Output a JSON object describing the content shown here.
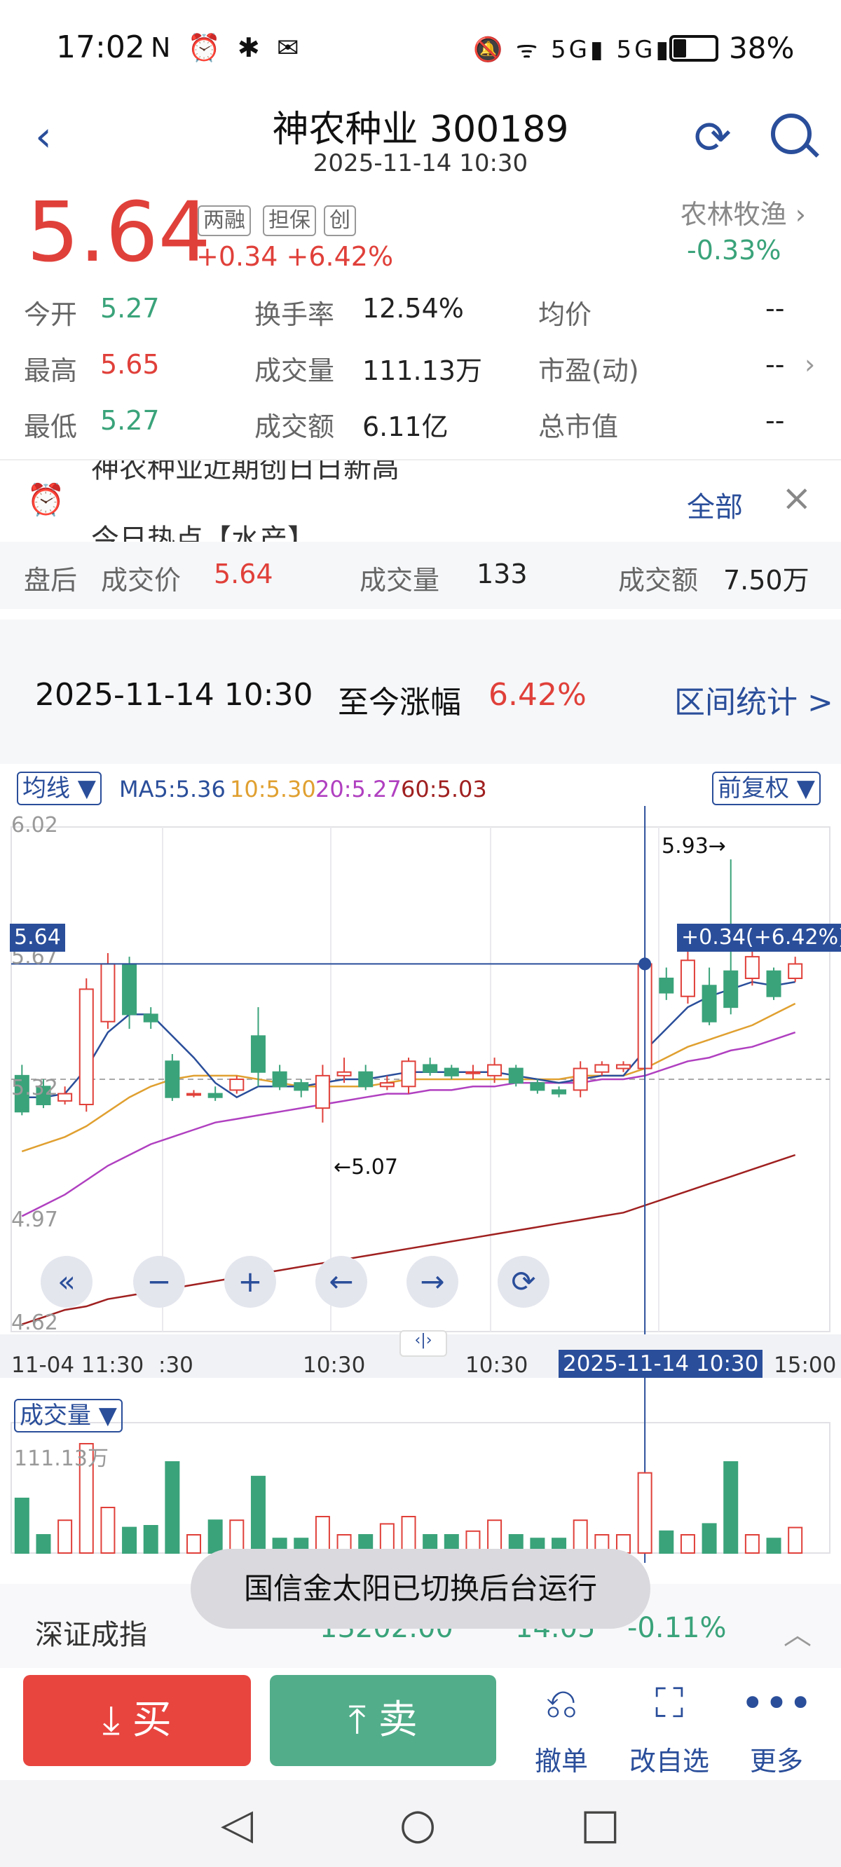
{
  "status": {
    "time": "17:02",
    "icons_left": "N ⏰ ✱ ✉",
    "icons_right": "🔕 ᯤ 5G▮ 5G▮",
    "battery_pct": "38%"
  },
  "header": {
    "title": "神农种业 300189",
    "subtitle": "2025-11-14 10:30"
  },
  "quote": {
    "price": "5.64",
    "tags": [
      "两融",
      "担保",
      "创"
    ],
    "change": "+0.34 +6.42%",
    "sector": "农林牧渔 ›",
    "sector_change": "-0.33%",
    "stats": [
      [
        {
          "label": "今开",
          "value": "5.27",
          "color": "green"
        },
        {
          "label": "换手率",
          "value": "12.54%"
        },
        {
          "label": "均价",
          "value": "--"
        }
      ],
      [
        {
          "label": "最高",
          "value": "5.65",
          "color": "red"
        },
        {
          "label": "成交量",
          "value": "111.13万"
        },
        {
          "label": "市盈(动)",
          "value": "--"
        }
      ],
      [
        {
          "label": "最低",
          "value": "5.27",
          "color": "green"
        },
        {
          "label": "成交额",
          "value": "6.11亿"
        },
        {
          "label": "总市值",
          "value": "--"
        }
      ]
    ]
  },
  "news": {
    "line1": "神农种业近期创日日新高",
    "line2": "今日热点【水产】",
    "all": "全部"
  },
  "after_hours": {
    "label": "盘后",
    "price_label": "成交价",
    "price": "5.64",
    "vol_label": "成交量",
    "vol": "133",
    "amt_label": "成交额",
    "amt": "7.50万"
  },
  "interval": {
    "date": "2025-11-14 10:30",
    "label": "至今涨幅",
    "value": "6.42%",
    "stats": "区间统计 >"
  },
  "chart_header": {
    "ma_button": "均线 ▼",
    "ma5": "MA5:5.36",
    "ma10": "10:5.30",
    "ma20": "20:5.27",
    "ma60": "60:5.03",
    "adjust": "前复权 ▼",
    "vol_button": "成交量 ▼"
  },
  "chart_data": {
    "type": "candlestick",
    "ylim": [
      4.62,
      6.02
    ],
    "y_ticks": [
      "6.02",
      "5.67",
      "5.32",
      "4.97",
      "4.62"
    ],
    "x_labels": [
      "11-04 11:30",
      ":30",
      "10:30",
      "10:30",
      "2025-11-14 10:30",
      "15:00"
    ],
    "crosshair_price": "5.64",
    "crosshair_label": "+0.34(+6.42%)",
    "high_annotation": "5.93→",
    "low_annotation": "←5.07",
    "candles": [
      {
        "o": 5.33,
        "c": 5.23,
        "h": 5.36,
        "l": 5.22
      },
      {
        "o": 5.3,
        "c": 5.25,
        "h": 5.32,
        "l": 5.24
      },
      {
        "o": 5.26,
        "c": 5.28,
        "h": 5.3,
        "l": 5.25
      },
      {
        "o": 5.25,
        "c": 5.57,
        "h": 5.6,
        "l": 5.23
      },
      {
        "o": 5.48,
        "c": 5.64,
        "h": 5.67,
        "l": 5.46
      },
      {
        "o": 5.64,
        "c": 5.5,
        "h": 5.66,
        "l": 5.46
      },
      {
        "o": 5.5,
        "c": 5.48,
        "h": 5.52,
        "l": 5.46
      },
      {
        "o": 5.37,
        "c": 5.27,
        "h": 5.39,
        "l": 5.26
      },
      {
        "o": 5.28,
        "c": 5.28,
        "h": 5.29,
        "l": 5.27
      },
      {
        "o": 5.28,
        "c": 5.27,
        "h": 5.3,
        "l": 5.26
      },
      {
        "o": 5.29,
        "c": 5.32,
        "h": 5.33,
        "l": 5.28
      },
      {
        "o": 5.44,
        "c": 5.34,
        "h": 5.52,
        "l": 5.3
      },
      {
        "o": 5.34,
        "c": 5.3,
        "h": 5.36,
        "l": 5.29
      },
      {
        "o": 5.31,
        "c": 5.29,
        "h": 5.32,
        "l": 5.27
      },
      {
        "o": 5.24,
        "c": 5.33,
        "h": 5.36,
        "l": 5.2
      },
      {
        "o": 5.33,
        "c": 5.34,
        "h": 5.38,
        "l": 5.31
      },
      {
        "o": 5.34,
        "c": 5.3,
        "h": 5.36,
        "l": 5.29
      },
      {
        "o": 5.3,
        "c": 5.31,
        "h": 5.33,
        "l": 5.29
      },
      {
        "o": 5.3,
        "c": 5.37,
        "h": 5.38,
        "l": 5.28
      },
      {
        "o": 5.36,
        "c": 5.34,
        "h": 5.38,
        "l": 5.33
      },
      {
        "o": 5.35,
        "c": 5.33,
        "h": 5.36,
        "l": 5.32
      },
      {
        "o": 5.34,
        "c": 5.34,
        "h": 5.36,
        "l": 5.32
      },
      {
        "o": 5.33,
        "c": 5.36,
        "h": 5.38,
        "l": 5.31
      },
      {
        "o": 5.35,
        "c": 5.31,
        "h": 5.36,
        "l": 5.3
      },
      {
        "o": 5.31,
        "c": 5.29,
        "h": 5.32,
        "l": 5.28
      },
      {
        "o": 5.29,
        "c": 5.28,
        "h": 5.3,
        "l": 5.27
      },
      {
        "o": 5.29,
        "c": 5.35,
        "h": 5.37,
        "l": 5.27
      },
      {
        "o": 5.34,
        "c": 5.36,
        "h": 5.37,
        "l": 5.33
      },
      {
        "o": 5.35,
        "c": 5.36,
        "h": 5.37,
        "l": 5.34
      },
      {
        "o": 5.35,
        "c": 5.64,
        "h": 5.65,
        "l": 5.33
      },
      {
        "o": 5.6,
        "c": 5.56,
        "h": 5.63,
        "l": 5.54
      },
      {
        "o": 5.55,
        "c": 5.65,
        "h": 5.68,
        "l": 5.53
      },
      {
        "o": 5.58,
        "c": 5.48,
        "h": 5.63,
        "l": 5.47
      },
      {
        "o": 5.62,
        "c": 5.52,
        "h": 5.93,
        "l": 5.5
      },
      {
        "o": 5.6,
        "c": 5.66,
        "h": 5.68,
        "l": 5.58
      },
      {
        "o": 5.62,
        "c": 5.55,
        "h": 5.63,
        "l": 5.54
      },
      {
        "o": 5.6,
        "c": 5.64,
        "h": 5.66,
        "l": 5.59
      }
    ],
    "ma5": [
      5.27,
      5.27,
      5.28,
      5.35,
      5.45,
      5.5,
      5.5,
      5.44,
      5.38,
      5.31,
      5.27,
      5.3,
      5.3,
      5.3,
      5.31,
      5.32,
      5.32,
      5.33,
      5.34,
      5.34,
      5.34,
      5.34,
      5.34,
      5.33,
      5.32,
      5.31,
      5.32,
      5.33,
      5.33,
      5.4,
      5.46,
      5.52,
      5.55,
      5.57,
      5.59,
      5.58,
      5.59
    ],
    "ma10": [
      5.12,
      5.14,
      5.16,
      5.19,
      5.23,
      5.27,
      5.3,
      5.32,
      5.33,
      5.33,
      5.33,
      5.32,
      5.31,
      5.3,
      5.3,
      5.3,
      5.3,
      5.31,
      5.32,
      5.32,
      5.32,
      5.32,
      5.32,
      5.32,
      5.32,
      5.32,
      5.33,
      5.33,
      5.33,
      5.35,
      5.38,
      5.41,
      5.43,
      5.45,
      5.47,
      5.5,
      5.53
    ],
    "ma20": [
      4.94,
      4.97,
      5.0,
      5.04,
      5.08,
      5.11,
      5.14,
      5.16,
      5.18,
      5.2,
      5.21,
      5.22,
      5.23,
      5.24,
      5.25,
      5.26,
      5.27,
      5.28,
      5.28,
      5.29,
      5.29,
      5.3,
      5.3,
      5.31,
      5.31,
      5.31,
      5.31,
      5.32,
      5.32,
      5.33,
      5.35,
      5.37,
      5.38,
      5.4,
      5.41,
      5.43,
      5.45
    ],
    "ma60": [
      4.64,
      4.66,
      4.68,
      4.69,
      4.71,
      4.72,
      4.73,
      4.74,
      4.75,
      4.76,
      4.77,
      4.78,
      4.79,
      4.8,
      4.81,
      4.82,
      4.83,
      4.84,
      4.85,
      4.86,
      4.87,
      4.88,
      4.89,
      4.9,
      4.91,
      4.92,
      4.93,
      4.94,
      4.95,
      4.97,
      4.99,
      5.01,
      5.03,
      5.05,
      5.07,
      5.09,
      5.11
    ],
    "volume_max_label": "111.13万",
    "volume": [
      30,
      10,
      18,
      60,
      25,
      14,
      15,
      50,
      10,
      18,
      18,
      42,
      8,
      8,
      20,
      10,
      10,
      16,
      20,
      10,
      10,
      12,
      18,
      10,
      8,
      8,
      18,
      10,
      10,
      44,
      12,
      10,
      16,
      50,
      10,
      8,
      14
    ]
  },
  "chart_controls": [
    "«",
    "−",
    "+",
    "←",
    "→",
    "⟳"
  ],
  "index_bar": {
    "name": "深证成指",
    "value": "13202.00",
    "change": "14.05",
    "pct": "-0.11%",
    "arrow": "︿"
  },
  "toast": "国信金太阳已切换后台运行",
  "trade": {
    "buy": "⤓ 买",
    "sell": "⤒ 卖"
  },
  "tools": [
    {
      "icon": "⎌",
      "label": "撤单"
    },
    {
      "icon": "⛶",
      "label": "改自选"
    },
    {
      "icon": "•••",
      "label": "更多"
    }
  ],
  "nav": {
    "back": "◁",
    "home": "○",
    "recent": "□"
  }
}
